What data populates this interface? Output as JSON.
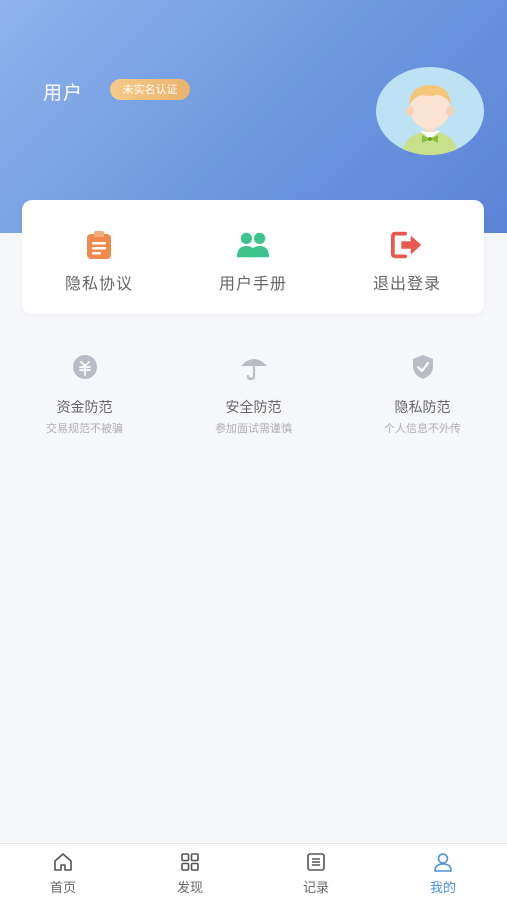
{
  "profile": {
    "username": "用户",
    "verify_badge": "未实名认证"
  },
  "actions": [
    {
      "label": "隐私协议",
      "icon": "clipboard-icon",
      "color": "#f08a4b"
    },
    {
      "label": "用户手册",
      "icon": "users-icon",
      "color": "#3cc48c"
    },
    {
      "label": "退出登录",
      "icon": "logout-icon",
      "color": "#e85a4f"
    }
  ],
  "tips": [
    {
      "title": "资金防范",
      "subtitle": "交易规范不被骗",
      "icon": "money-icon"
    },
    {
      "title": "安全防范",
      "subtitle": "参加面试需谨慎",
      "icon": "umbrella-icon"
    },
    {
      "title": "隐私防范",
      "subtitle": "个人信息不外传",
      "icon": "shield-check-icon"
    }
  ],
  "tabbar": [
    {
      "label": "首页",
      "icon": "home-icon",
      "active": false
    },
    {
      "label": "发现",
      "icon": "grid-icon",
      "active": false
    },
    {
      "label": "记录",
      "icon": "record-icon",
      "active": false
    },
    {
      "label": "我的",
      "icon": "user-icon",
      "active": true
    }
  ],
  "colors": {
    "header_gradient_start": "#8fb4ec",
    "header_gradient_end": "#5b83d8",
    "badge": "#eab36c",
    "tab_active": "#4a90e2",
    "background": "#f6f7fb"
  }
}
